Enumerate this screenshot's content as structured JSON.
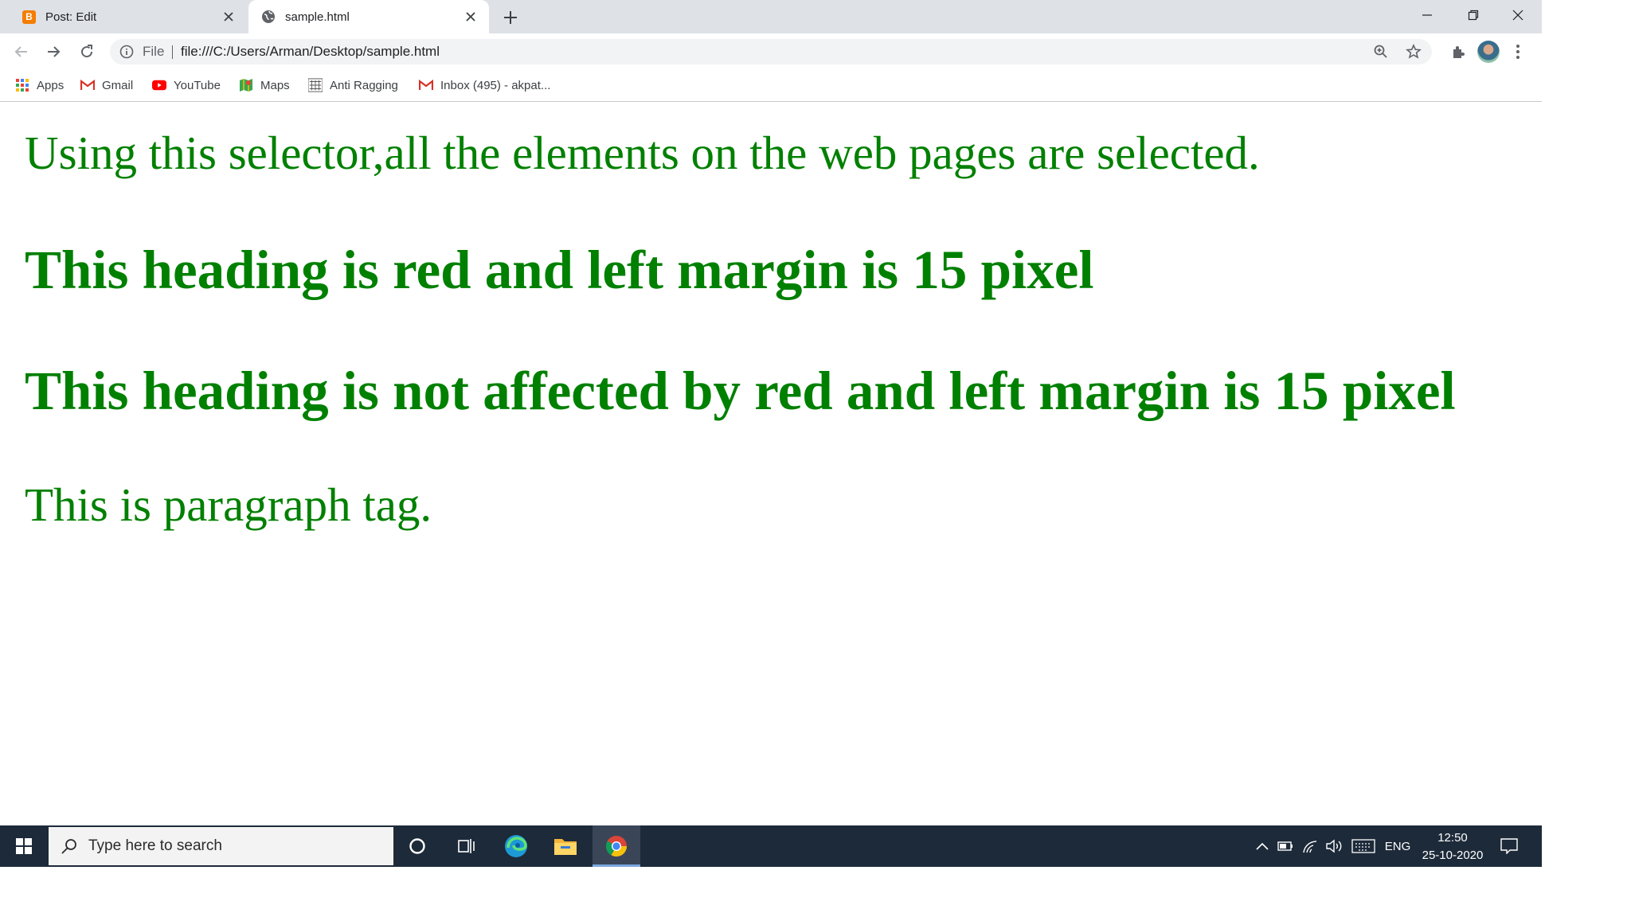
{
  "tabs": [
    {
      "title": "Post: Edit",
      "favicon": "blogger-icon",
      "active": false
    },
    {
      "title": "sample.html",
      "favicon": "globe-icon",
      "active": true
    }
  ],
  "toolbar": {
    "scheme": "File",
    "url": "file:///C:/Users/Arman/Desktop/sample.html"
  },
  "bookmarks": [
    {
      "label": "Apps",
      "icon": "apps-grid-icon"
    },
    {
      "label": "Gmail",
      "icon": "gmail-icon"
    },
    {
      "label": "YouTube",
      "icon": "youtube-icon"
    },
    {
      "label": "Maps",
      "icon": "maps-icon"
    },
    {
      "label": "Anti Ragging",
      "icon": "anti-ragging-icon"
    },
    {
      "label": "Inbox (495) - akpat...",
      "icon": "gmail-icon"
    }
  ],
  "page": {
    "paragraph1": "Using this selector,all the elements on the web pages are selected.",
    "heading1": "This heading is red and left margin is 15 pixel",
    "heading2": "This heading is not affected by red and left margin is 15 pixel",
    "paragraph2": "This is paragraph tag.",
    "text_color": "#008000"
  },
  "taskbar": {
    "search_placeholder": "Type here to search",
    "language": "ENG",
    "time": "12:50",
    "date": "25-10-2020"
  },
  "colors": {
    "tabstrip_bg": "#dee1e6",
    "taskbar_bg": "#1d2a3a",
    "blogger_orange": "#f57d00",
    "youtube_red": "#ff0000"
  }
}
